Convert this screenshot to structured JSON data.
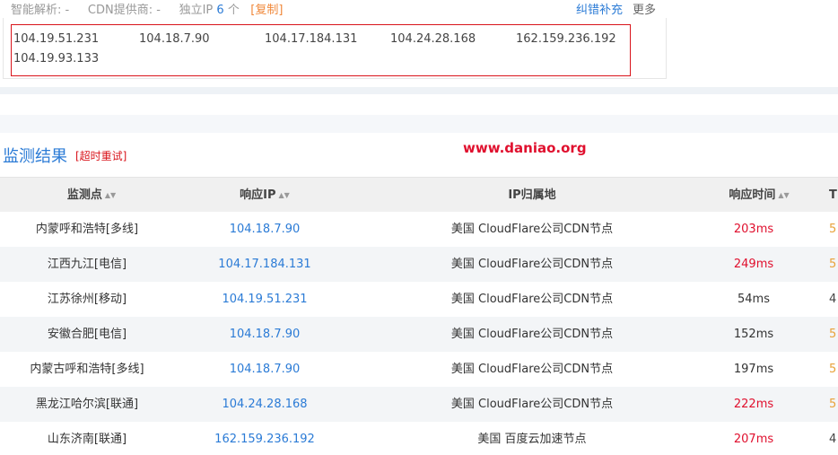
{
  "top": {
    "smart_dns_label": "智能解析: -",
    "cdn_label": "CDN提供商: -",
    "unique_ip_label": "独立IP",
    "unique_ip_count": "6",
    "unique_ip_unit": "个",
    "copy_label": "[复制]",
    "fix_link": "纠错补充",
    "more_link": "更多"
  },
  "ips": [
    "104.19.51.231",
    "104.18.7.90",
    "104.17.184.131",
    "104.24.28.168",
    "162.159.236.192",
    "104.19.93.133"
  ],
  "section": {
    "title": "监测结果",
    "retry": "[超时重试]",
    "watermark": "www.daniao.org"
  },
  "table": {
    "headers": {
      "point": "监测点",
      "ip": "响应IP",
      "location": "IP归属地",
      "time": "响应时间",
      "edge": "T"
    },
    "rows": [
      {
        "point": "内蒙呼和浩特[多线]",
        "ip": "104.18.7.90",
        "location": "美国 CloudFlare公司CDN节点",
        "time": "203ms",
        "slow": true
      },
      {
        "point": "江西九江[电信]",
        "ip": "104.17.184.131",
        "location": "美国 CloudFlare公司CDN节点",
        "time": "249ms",
        "slow": true
      },
      {
        "point": "江苏徐州[移动]",
        "ip": "104.19.51.231",
        "location": "美国 CloudFlare公司CDN节点",
        "time": "54ms",
        "slow": false
      },
      {
        "point": "安徽合肥[电信]",
        "ip": "104.18.7.90",
        "location": "美国 CloudFlare公司CDN节点",
        "time": "152ms",
        "slow": false
      },
      {
        "point": "内蒙古呼和浩特[多线]",
        "ip": "104.18.7.90",
        "location": "美国 CloudFlare公司CDN节点",
        "time": "197ms",
        "slow": false
      },
      {
        "point": "黑龙江哈尔滨[联通]",
        "ip": "104.24.28.168",
        "location": "美国 CloudFlare公司CDN节点",
        "time": "222ms",
        "slow": true
      },
      {
        "point": "山东济南[联通]",
        "ip": "162.159.236.192",
        "location": "美国 百度云加速节点",
        "time": "207ms",
        "slow": true
      }
    ]
  },
  "colors": {
    "link": "#2b7bd6",
    "slow_time": "#e0102e",
    "highlight_border": "#d9141b"
  }
}
